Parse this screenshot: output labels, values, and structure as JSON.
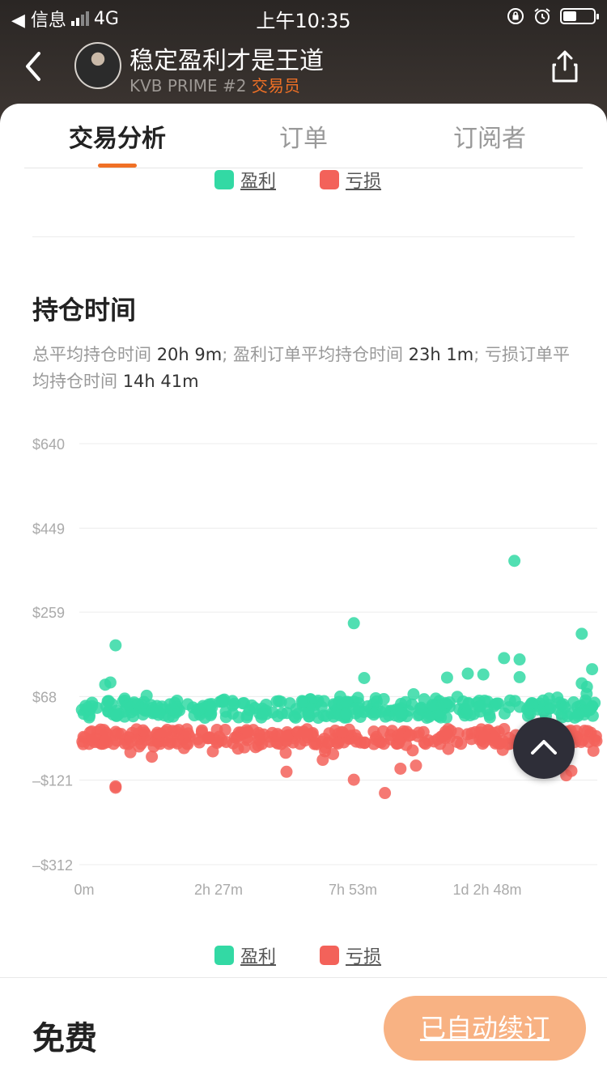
{
  "status_bar": {
    "back_app": "◀ 信息",
    "network": "4G",
    "time": "上午10:35"
  },
  "header": {
    "title": "稳定盈利才是王道",
    "subtitle_prefix": "KVB PRIME #2",
    "role": "交易员"
  },
  "tabs": [
    {
      "label": "交易分析",
      "active": true
    },
    {
      "label": "订单",
      "active": false
    },
    {
      "label": "订阅者",
      "active": false
    }
  ],
  "legend": {
    "profit": "盈利",
    "loss": "亏损",
    "profit_color": "#33d9a4",
    "loss_color": "#f3625a"
  },
  "holding": {
    "heading": "持仓时间",
    "desc_1": "总平均持仓时间",
    "val_1": "20h 9m",
    "desc_2": "; 盈利订单平均持仓时间",
    "val_2": "23h 1m",
    "desc_3": "; 亏损订单平均持仓时间",
    "val_3": "14h 41m"
  },
  "chart_data": {
    "type": "scatter",
    "y_ticks": [
      "$640",
      "$449",
      "$259",
      "$68",
      "–$121",
      "–$312"
    ],
    "y_tick_values": [
      640,
      449,
      259,
      68,
      -121,
      -312
    ],
    "x_ticks": [
      "0m",
      "2h 27m",
      "7h 53m",
      "1d 2h 48m"
    ],
    "ylim": [
      -312,
      640
    ],
    "grid": true,
    "series": [
      {
        "name": "盈利",
        "color": "#33d9a4",
        "highlights": [
          [
            0.07,
            184
          ],
          [
            0.05,
            95
          ],
          [
            0.06,
            100
          ],
          [
            0.13,
            70
          ],
          [
            0.53,
            234
          ],
          [
            0.55,
            110
          ],
          [
            0.84,
            375
          ],
          [
            0.82,
            155
          ],
          [
            0.85,
            152
          ],
          [
            0.85,
            112
          ],
          [
            0.78,
            118
          ],
          [
            0.97,
            210
          ],
          [
            0.99,
            130
          ],
          [
            0.97,
            98
          ],
          [
            0.71,
            111
          ],
          [
            0.75,
            120
          ],
          [
            0.98,
            90
          ]
        ],
        "band": [
          20,
          60
        ]
      },
      {
        "name": "亏损",
        "color": "#f3625a",
        "highlights": [
          [
            0.07,
            -138
          ],
          [
            0.07,
            -135
          ],
          [
            0.53,
            -120
          ],
          [
            0.59,
            -150
          ],
          [
            0.62,
            -95
          ],
          [
            0.4,
            -102
          ],
          [
            0.14,
            -68
          ],
          [
            0.65,
            -88
          ],
          [
            0.94,
            -110
          ],
          [
            0.95,
            -100
          ],
          [
            0.47,
            -75
          ],
          [
            0.49,
            -62
          ]
        ],
        "band": [
          -40,
          -5
        ]
      }
    ]
  },
  "bottom": {
    "price": "免费",
    "renew_button": "已自动续订"
  }
}
